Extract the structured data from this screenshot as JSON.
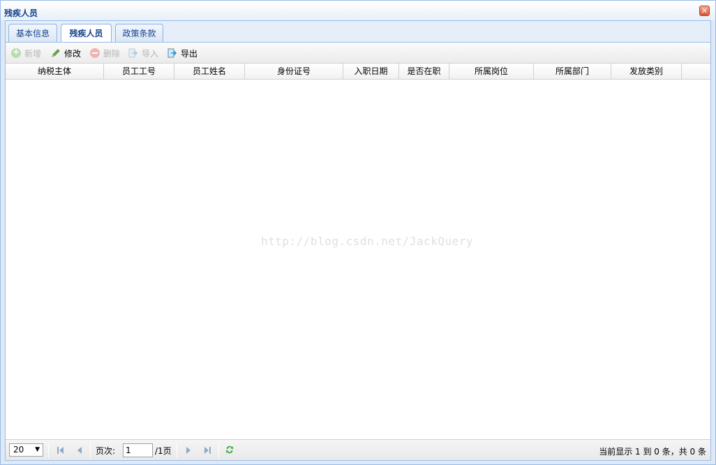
{
  "window": {
    "title": "残疾人员",
    "close_symbol": "✕"
  },
  "tabs": [
    {
      "label": "基本信息",
      "active": false
    },
    {
      "label": "残疾人员",
      "active": true
    },
    {
      "label": "政策条款",
      "active": false
    }
  ],
  "toolbar": {
    "add_label": "新增",
    "edit_label": "修改",
    "delete_label": "删除",
    "import_label": "导入",
    "export_label": "导出"
  },
  "grid": {
    "columns": [
      "纳税主体",
      "员工工号",
      "员工姓名",
      "身份证号",
      "入职日期",
      "是否在职",
      "所属岗位",
      "所属部门",
      "发放类别"
    ],
    "rows": [],
    "watermark": "http://blog.csdn.net/JackQuery"
  },
  "pager": {
    "page_size": "20",
    "page_label": "页次:",
    "page_value": "1",
    "total_pages": "/1页",
    "info": "当前显示 1 到 0 条，共 0 条"
  },
  "colors": {
    "title_text": "#15428b",
    "border": "#99bbe8",
    "refresh_icon": "#3aa83a"
  }
}
